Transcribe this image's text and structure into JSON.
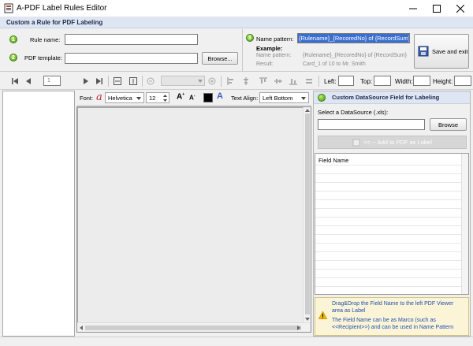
{
  "window": {
    "title": "A-PDF Label Rules Editor"
  },
  "section_title": "Custom a Rule for PDF Labeling",
  "rule_form": {
    "rule_name_label": "Rule name:",
    "rule_name_value": "",
    "pdf_template_label": "PDF template:",
    "pdf_template_value": "",
    "browse_label": "Browse...",
    "step1": "1",
    "step2": "2",
    "step3": "3"
  },
  "name_pattern": {
    "label": "Name pattern:",
    "value": "{Rulename}_{RecoredNo} of {RecordSum}",
    "example_title": "Example:",
    "example_name_label": "Name pattern:",
    "example_name_value": "{Rulename}_{RecoredNo} of {RecordSum}",
    "example_result_label": "Result:",
    "example_result_value": "Card_1 of 10 to Mr. Smith"
  },
  "save_exit_label": "Save and exit",
  "toolbar": {
    "page_number": "1",
    "left_label": "Left:",
    "top_label": "Top:",
    "width_label": "Width:",
    "height_label": "Height:"
  },
  "viewer_tools": {
    "font_label": "Font:",
    "font_value": "Helvetica",
    "size_value": "12",
    "text_align_label": "Text Align:",
    "text_align_value": "Left Bottom"
  },
  "datasource": {
    "header": "Custom DataSource Field for Labeling",
    "select_label": "Select a DataSource (.xls):",
    "select_value": "",
    "browse_label": "Browse",
    "add_button_label": "<< -- Add to PDF as Label",
    "grid_header": "Field Name",
    "fields": [],
    "tip_line1": "Drag&Drop the Field Name to the left PDF Viewer area as Label",
    "tip_line2": "The Field Name can be as Marco (such as <<Recipient>>) and can be used in Name Pattern"
  },
  "colors": {
    "band": "#dfe6f3",
    "accent_green": "#4d9a12",
    "selection": "#3a6fd0"
  }
}
